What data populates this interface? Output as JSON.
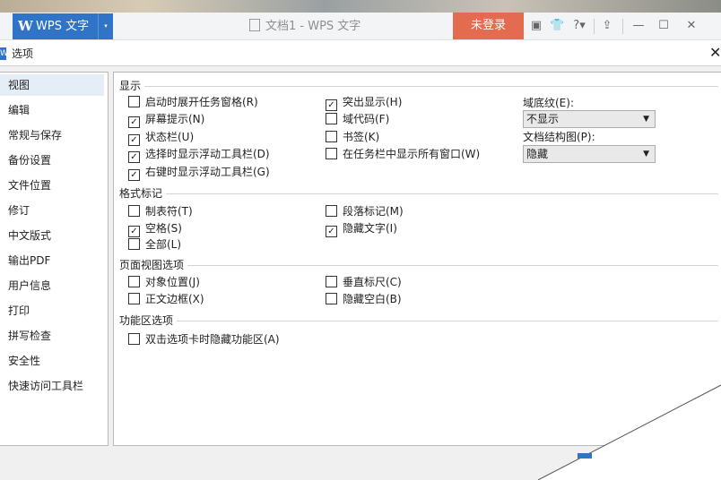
{
  "titlebar": {
    "app_logo": "W",
    "app_name": "WPS 文字",
    "dropdown_glyph": "▾",
    "document_title": "文档1 - WPS 文字",
    "login_label": "未登录",
    "help_label": "?",
    "icons": [
      "skin-icon",
      "shirt-icon",
      "help-icon",
      "pin-icon",
      "minimize-icon",
      "maximize-icon",
      "close-icon"
    ]
  },
  "dialog": {
    "title": "选项",
    "icon_letter": "W",
    "close_glyph": "✕"
  },
  "nav": {
    "items": [
      "视图",
      "编辑",
      "常规与保存",
      "备份设置",
      "文件位置",
      "修订",
      "中文版式",
      "输出PDF",
      "用户信息",
      "打印",
      "拼写检查",
      "安全性",
      "快速访问工具栏"
    ],
    "active_index": 0
  },
  "groups": {
    "display": "显示",
    "format_marks": "格式标记",
    "page_view": "页面视图选项",
    "ribbon": "功能区选项"
  },
  "checkboxes": {
    "display": [
      {
        "label": "启动时展开任务窗格(R)",
        "checked": false
      },
      {
        "label": "屏幕提示(N)",
        "checked": true
      },
      {
        "label": "状态栏(U)",
        "checked": true
      },
      {
        "label": "选择时显示浮动工具栏(D)",
        "checked": true
      },
      {
        "label": "右键时显示浮动工具栏(G)",
        "checked": true
      },
      {
        "label": "突出显示(H)",
        "checked": true
      },
      {
        "label": "域代码(F)",
        "checked": false
      },
      {
        "label": "书签(K)",
        "checked": false
      },
      {
        "label": "在任务栏中显示所有窗口(W)",
        "checked": false
      }
    ],
    "format_marks": [
      {
        "label": "制表符(T)",
        "checked": false
      },
      {
        "label": "空格(S)",
        "checked": true
      },
      {
        "label": "全部(L)",
        "checked": false
      },
      {
        "label": "段落标记(M)",
        "checked": false
      },
      {
        "label": "隐藏文字(I)",
        "checked": true
      }
    ],
    "page_view": [
      {
        "label": "对象位置(J)",
        "checked": false
      },
      {
        "label": "正文边框(X)",
        "checked": false
      },
      {
        "label": "垂直标尺(C)",
        "checked": false
      },
      {
        "label": "隐藏空白(B)",
        "checked": false
      }
    ],
    "ribbon": [
      {
        "label": "双击选项卡时隐藏功能区(A)",
        "checked": false
      }
    ]
  },
  "fields": {
    "field_shading": {
      "label": "域底纹(E):",
      "value": "不显示"
    },
    "doc_map": {
      "label": "文档结构图(P):",
      "value": "隐藏"
    }
  },
  "glyphs": {
    "check": "✓",
    "arrow": "▼"
  }
}
